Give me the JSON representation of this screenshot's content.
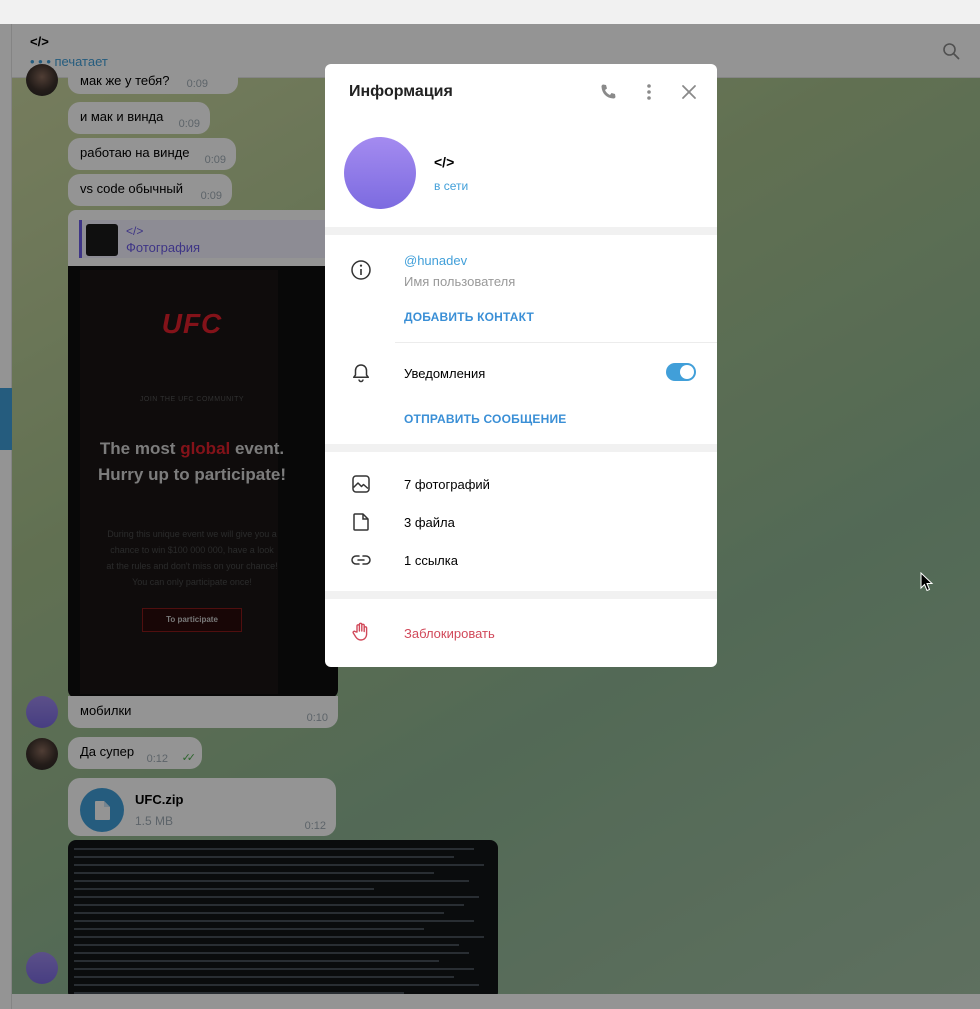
{
  "chat": {
    "title": "</>",
    "typing_status": "• • • печатает",
    "messages": [
      {
        "text": "мак же у тебя?",
        "time": "0:09"
      },
      {
        "text": "и мак и винда",
        "time": "0:09"
      },
      {
        "text": "работаю на винде",
        "time": "0:09"
      },
      {
        "text": "vs code обычный",
        "time": "0:09"
      },
      {
        "text": "мобилки",
        "time": "0:10"
      },
      {
        "text": "Да супер",
        "time": "0:12"
      }
    ],
    "reply": {
      "name": "</>",
      "text": "Фотография"
    },
    "poster": {
      "logo": "UFC",
      "join": "JOIN THE UFC COMMUNITY",
      "headline_pre": "The most ",
      "headline_accent": "global",
      "headline_post": " event. Hurry up to participate!",
      "body": "During this unique event we will give you a chance to win $100 000 000, have a look at the rules and don't miss on your chance! You can only participate once!",
      "cta": "To participate"
    },
    "file": {
      "name": "UFC.zip",
      "size": "1.5 MB",
      "time": "0:12"
    }
  },
  "modal": {
    "title": "Информация",
    "contact_name": "</>",
    "online_status": "в сети",
    "username": "@hunadev",
    "username_label": "Имя пользователя",
    "add_contact": "ДОБАВИТЬ КОНТАКТ",
    "notifications_label": "Уведомления",
    "notifications_enabled": true,
    "send_message": "ОТПРАВИТЬ СООБЩЕНИЕ",
    "photos": "7 фотографий",
    "files": "3 файла",
    "links": "1 ссылка",
    "block": "Заблокировать"
  },
  "colors": {
    "accent": "#419fd9",
    "danger": "#d1495a",
    "reply": "#6c5ce7"
  }
}
